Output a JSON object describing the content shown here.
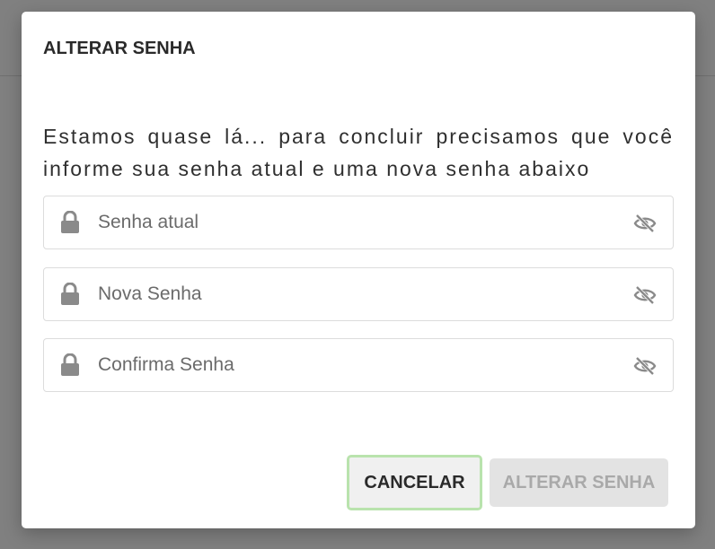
{
  "dialog": {
    "title": "ALTERAR SENHA",
    "message": "Estamos quase lá... para concluir precisamos que você informe sua senha atual e uma nova senha abaixo"
  },
  "fields": [
    {
      "placeholder": "Senha atual",
      "value": "",
      "icon": "lock-icon",
      "toggle_icon": "eye-slash-icon"
    },
    {
      "placeholder": "Nova Senha",
      "value": "",
      "icon": "lock-icon",
      "toggle_icon": "eye-slash-icon"
    },
    {
      "placeholder": "Confirma Senha",
      "value": "",
      "icon": "lock-icon",
      "toggle_icon": "eye-slash-icon"
    }
  ],
  "actions": {
    "cancel_label": "CANCELAR",
    "submit_label": "ALTERAR SENHA",
    "submit_enabled": false
  },
  "colors": {
    "backdrop": "#808080",
    "cancel_focus_ring": "#b9e3ad",
    "disabled_button_bg": "#e3e3e3",
    "disabled_button_text": "#a9a9a9",
    "icon_gray": "#8a8a8a"
  }
}
